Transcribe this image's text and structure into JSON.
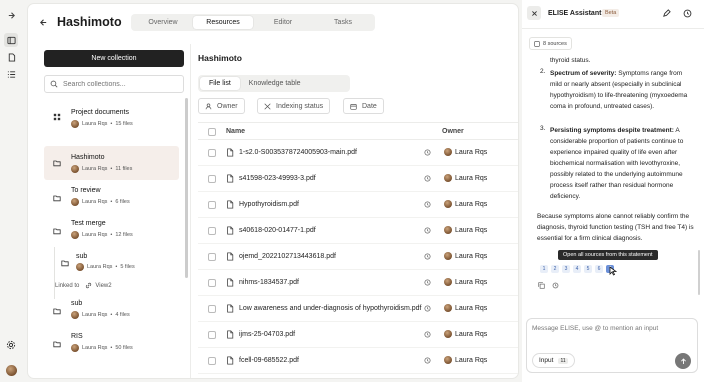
{
  "main": {
    "title": "Hashimoto",
    "tabs": [
      {
        "label": "Overview"
      },
      {
        "label": "Resources"
      },
      {
        "label": "Editor"
      },
      {
        "label": "Tasks"
      }
    ]
  },
  "collections": {
    "new_button": "New collection",
    "search_placeholder": "Search collections...",
    "items": [
      {
        "name": "Project documents",
        "owner": "Laura Rqs",
        "files": "15 files"
      },
      {
        "name": "Hashimoto",
        "owner": "Laura Rqs",
        "files": "11 files"
      },
      {
        "name": "To review",
        "owner": "Laura Rqs",
        "files": "6 files"
      },
      {
        "name": "Test merge",
        "owner": "Laura Rqs",
        "files": "12 files"
      },
      {
        "name": "sub",
        "owner": "Laura Rqs",
        "files": "5 files"
      },
      {
        "name": "sub",
        "owner": "Laura Rqs",
        "files": "4 files"
      },
      {
        "name": "RIS",
        "owner": "Laura Rqs",
        "files": "50 files"
      }
    ],
    "linked_label": "Linked to",
    "linked_target": "View2"
  },
  "files": {
    "title": "Hashimoto",
    "tabs": [
      "File list",
      "Knowledge table"
    ],
    "filters": [
      "Owner",
      "Indexing status",
      "Date"
    ],
    "columns": {
      "name": "Name",
      "owner": "Owner"
    },
    "rows": [
      {
        "name": "1-s2.0-S0035378724005903-main.pdf",
        "owner": "Laura Rqs"
      },
      {
        "name": "s41598-023-49993-3.pdf",
        "owner": "Laura Rqs"
      },
      {
        "name": "Hypothyroidism.pdf",
        "owner": "Laura Rqs"
      },
      {
        "name": "s40618-020-01477-1.pdf",
        "owner": "Laura Rqs"
      },
      {
        "name": "ojemd_2022102713443618.pdf",
        "owner": "Laura Rqs"
      },
      {
        "name": "nihms-1834537.pdf",
        "owner": "Laura Rqs"
      },
      {
        "name": "Low awareness and under-diagnosis of hypothyroidism.pdf",
        "owner": "Laura Rqs"
      },
      {
        "name": "ijms-25-04703.pdf",
        "owner": "Laura Rqs"
      },
      {
        "name": "fcell-09-685522.pdf",
        "owner": "Laura Rqs"
      }
    ]
  },
  "assistant": {
    "title": "ELISE Assistant",
    "beta": "Beta",
    "sources": "8 sources",
    "message": {
      "line0": "thyroid status.",
      "item2_num": "2.",
      "item2_bold": "Spectrum of severity:",
      "item2_text": " Symptoms range from mild or nearly absent (especially in subclinical hypothyroidism) to life-threatening (myxoedema coma in profound, untreated cases).",
      "item3_num": "3.",
      "item3_bold": "Persisting symptoms despite treatment:",
      "item3_text": " A considerable proportion of patients continue to experience impaired quality of life even after biochemical normalisation with levothyroxine, possibly related to the underlying autoimmune process itself rather than residual hormone deficiency.",
      "conclusion": "Because symptoms alone cannot reliably confirm the diagnosis, thyroid function testing (TSH and free T4) is essential for a firm clinical diagnosis."
    },
    "citations": [
      "1",
      "2",
      "3",
      "4",
      "5",
      "6",
      "7"
    ],
    "tooltip": "Open all sources from this statement",
    "composer_placeholder": "Message ELISE, use @ to mention an input",
    "input_chip": "Input",
    "input_count": "11"
  }
}
